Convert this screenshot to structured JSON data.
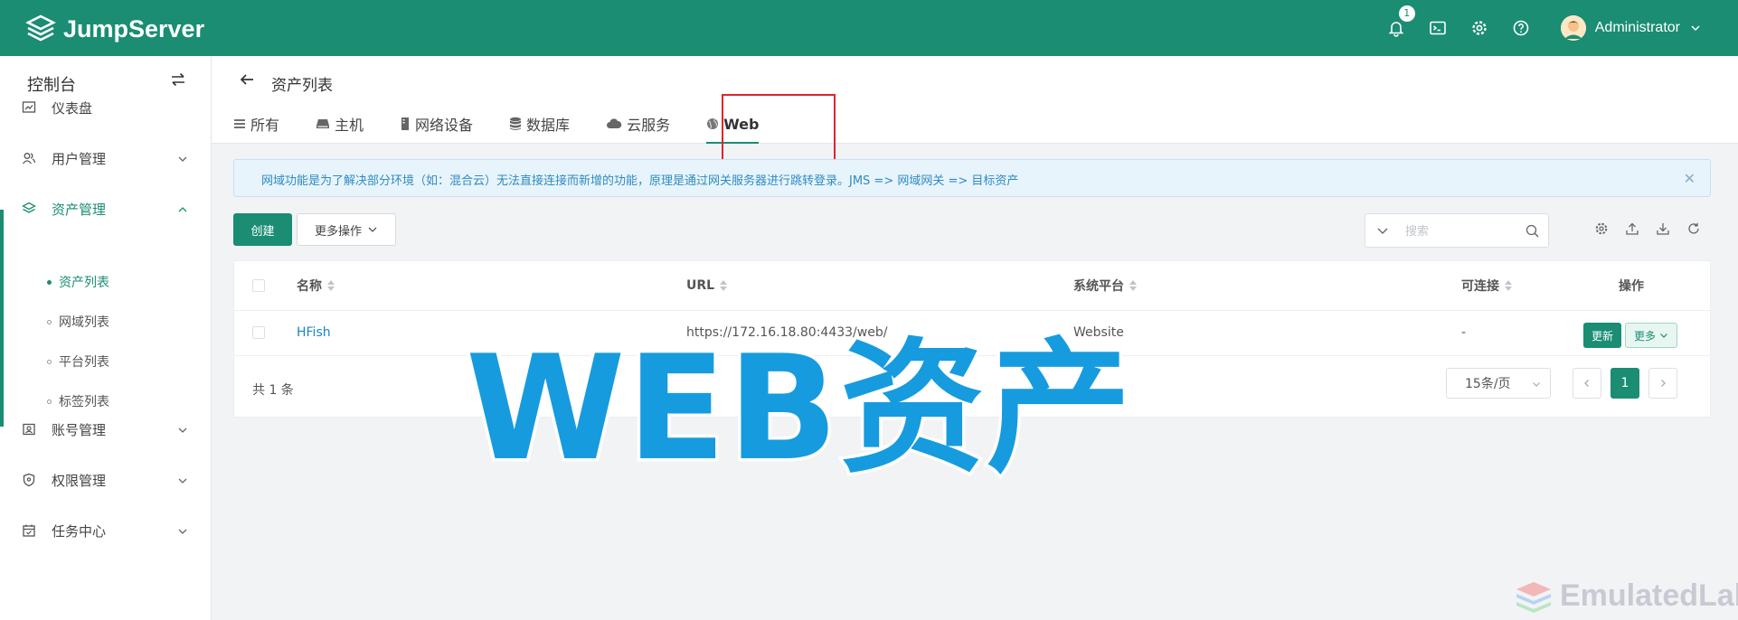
{
  "app": {
    "brand": "JumpServer",
    "accent_color": "#1a8d73"
  },
  "topbar": {
    "notifications_count": "1",
    "icons": [
      "bell-icon",
      "terminal-icon",
      "gear-icon",
      "help-icon"
    ],
    "user_name": "Administrator"
  },
  "sidebar": {
    "title": "控制台",
    "items": [
      {
        "label": "仪表盘",
        "icon": "dashboard-icon"
      },
      {
        "label": "用户管理",
        "icon": "users-icon"
      },
      {
        "label": "资产管理",
        "icon": "layers-icon",
        "active": true
      },
      {
        "label": "账号管理",
        "icon": "account-icon"
      },
      {
        "label": "权限管理",
        "icon": "shield-icon"
      },
      {
        "label": "任务中心",
        "icon": "calendar-icon"
      }
    ],
    "sub_items": [
      "资产列表",
      "网域列表",
      "平台列表",
      "标签列表"
    ]
  },
  "page": {
    "title": "资产列表",
    "tabs": [
      "所有",
      "主机",
      "网络设备",
      "数据库",
      "云服务",
      "Web"
    ],
    "active_tab": "Web"
  },
  "alert": {
    "text": "网域功能是为了解决部分环境（如：混合云）无法直接连接而新增的功能，原理是通过网关服务器进行跳转登录。JMS => 网域网关 => 目标资产"
  },
  "toolbar": {
    "create_label": "创建",
    "more_actions_label": "更多操作",
    "search_placeholder": "搜索"
  },
  "table": {
    "headers": {
      "name": "名称",
      "url": "URL",
      "platform": "系统平台",
      "connectable": "可连接",
      "actions": "操作"
    },
    "rows": [
      {
        "name": "HFish",
        "url": "https://172.16.18.80:4433/web/",
        "platform": "Website",
        "connectable": "-",
        "update_label": "更新",
        "more_label": "更多"
      }
    ]
  },
  "pagination": {
    "total": "共 1 条",
    "page_size": "15条/页",
    "current_page": "1"
  },
  "overlay": {
    "title": "WEB资产"
  },
  "watermark": {
    "text": "EmulatedLab"
  }
}
